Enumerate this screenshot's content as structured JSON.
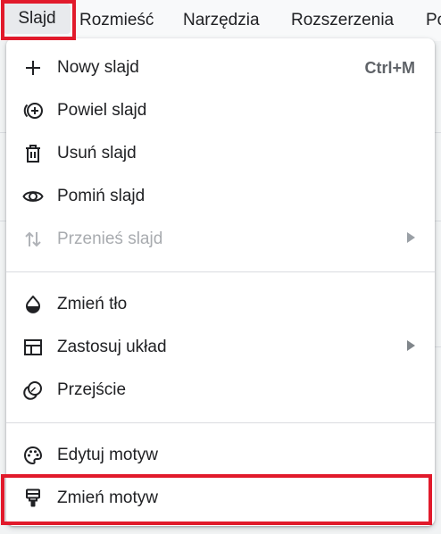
{
  "menubar": {
    "items": [
      "Slajd",
      "Rozmieść",
      "Narzędzia",
      "Rozszerzenia",
      "Po"
    ]
  },
  "menu": {
    "items": [
      {
        "label": "Nowy slajd",
        "icon": "plus-icon",
        "shortcut": "Ctrl+M"
      },
      {
        "label": "Powiel slajd",
        "icon": "duplicate-icon"
      },
      {
        "label": "Usuń slajd",
        "icon": "trash-icon"
      },
      {
        "label": "Pomiń slajd",
        "icon": "eye-icon"
      },
      {
        "label": "Przenieś slajd",
        "icon": "move-arrows-icon",
        "disabled": true,
        "submenu": true
      },
      {
        "label": "Zmień tło",
        "icon": "drop-icon"
      },
      {
        "label": "Zastosuj układ",
        "icon": "layout-icon",
        "submenu": true
      },
      {
        "label": "Przejście",
        "icon": "transition-icon"
      },
      {
        "label": "Edytuj motyw",
        "icon": "palette-icon"
      },
      {
        "label": "Zmień motyw",
        "icon": "paint-roller-icon"
      }
    ]
  },
  "colors": {
    "highlight": "#e11a2b",
    "text": "#202124",
    "disabled_text": "#a8abaf"
  }
}
